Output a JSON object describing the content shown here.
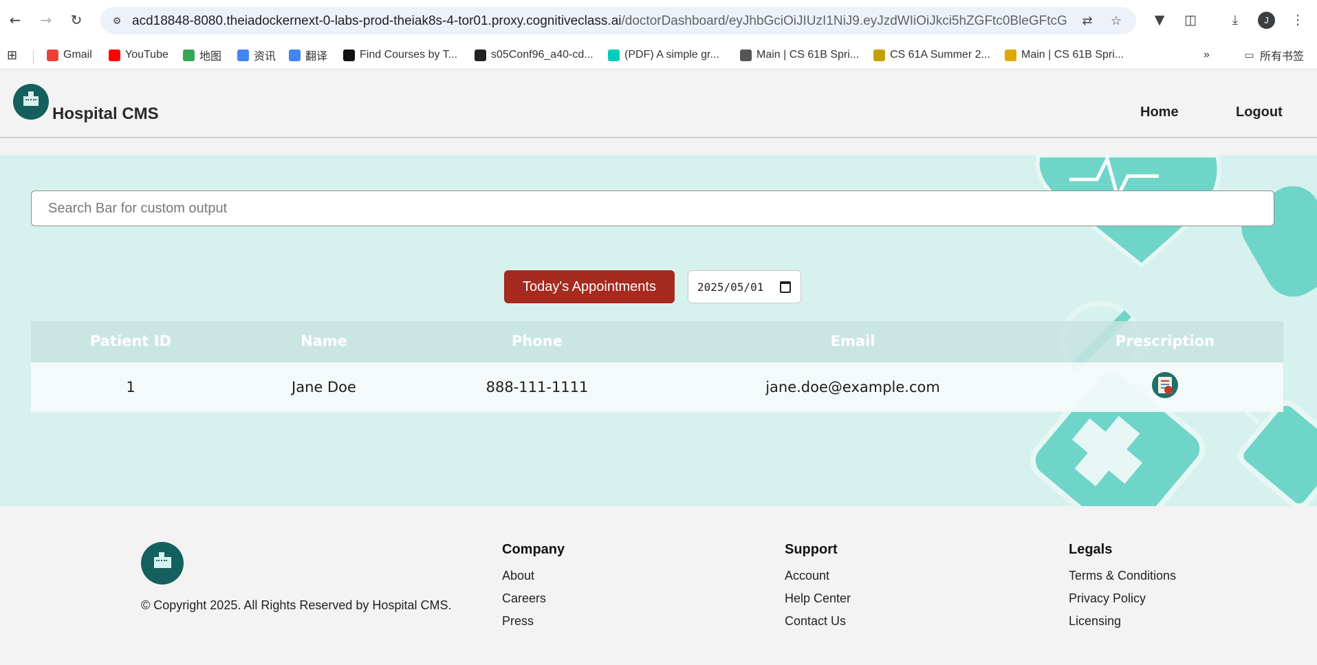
{
  "browser": {
    "url_host": "acd18848-8080.theiadockernext-0-labs-prod-theiak8s-4-tor01.proxy.cognitiveclass.ai",
    "url_path": "/doctorDashboard/eyJhbGciOiJIUzI1NiJ9.eyJzdWIiOiJkci5hZGFtc0BleGFtcGxl...",
    "avatar_letter": "J",
    "bookmarks": [
      {
        "label": "Gmail",
        "icon": "gmail-icon",
        "color": "#ea4335"
      },
      {
        "label": "YouTube",
        "icon": "youtube-icon",
        "color": "#ff0000"
      },
      {
        "label": "地图",
        "icon": "maps-icon",
        "color": "#34a853"
      },
      {
        "label": "资讯",
        "icon": "news-icon",
        "color": "#4285f4"
      },
      {
        "label": "翻译",
        "icon": "translate-icon",
        "color": "#4285f4"
      },
      {
        "label": "Find Courses by T...",
        "icon": "courses-icon",
        "color": "#111111"
      },
      {
        "label": "s05Conf96_a40-cd...",
        "icon": "github-icon",
        "color": "#222222"
      },
      {
        "label": "(PDF) A simple gr...",
        "icon": "researchgate-icon",
        "color": "#00ccbb"
      },
      {
        "label": "Main | CS 61B Spri...",
        "icon": "globe-icon",
        "color": "#555555"
      },
      {
        "label": "CS 61A Summer 2...",
        "icon": "berkeley-icon",
        "color": "#c4a000"
      },
      {
        "label": "Main | CS 61B Spri...",
        "icon": "emoji-icon",
        "color": "#e0a800"
      }
    ],
    "all_bookmarks_label": "所有书签"
  },
  "header": {
    "brand": "Hospital CMS",
    "nav": [
      "Home",
      "Logout"
    ]
  },
  "dashboard": {
    "search_placeholder": "Search Bar for custom output",
    "appointments_button": "Today's Appointments",
    "date_value": "2025/05/01",
    "columns": [
      "Patient ID",
      "Name",
      "Phone",
      "Email",
      "Prescription"
    ],
    "rows": [
      {
        "id": "1",
        "name": "Jane Doe",
        "phone": "888-111-1111",
        "email": "jane.doe@example.com",
        "prescription_icon": "prescription-icon"
      }
    ]
  },
  "footer": {
    "copyright": "© Copyright 2025. All Rights Reserved by Hospital CMS.",
    "columns": [
      {
        "title": "Company",
        "links": [
          "About",
          "Careers",
          "Press"
        ]
      },
      {
        "title": "Support",
        "links": [
          "Account",
          "Help Center",
          "Contact Us"
        ]
      },
      {
        "title": "Legals",
        "links": [
          "Terms & Conditions",
          "Privacy Policy",
          "Licensing"
        ]
      }
    ]
  },
  "colors": {
    "accent_button": "#a52a1f",
    "hero_bg": "#d6f1ee",
    "logo_bg": "#14605f"
  }
}
